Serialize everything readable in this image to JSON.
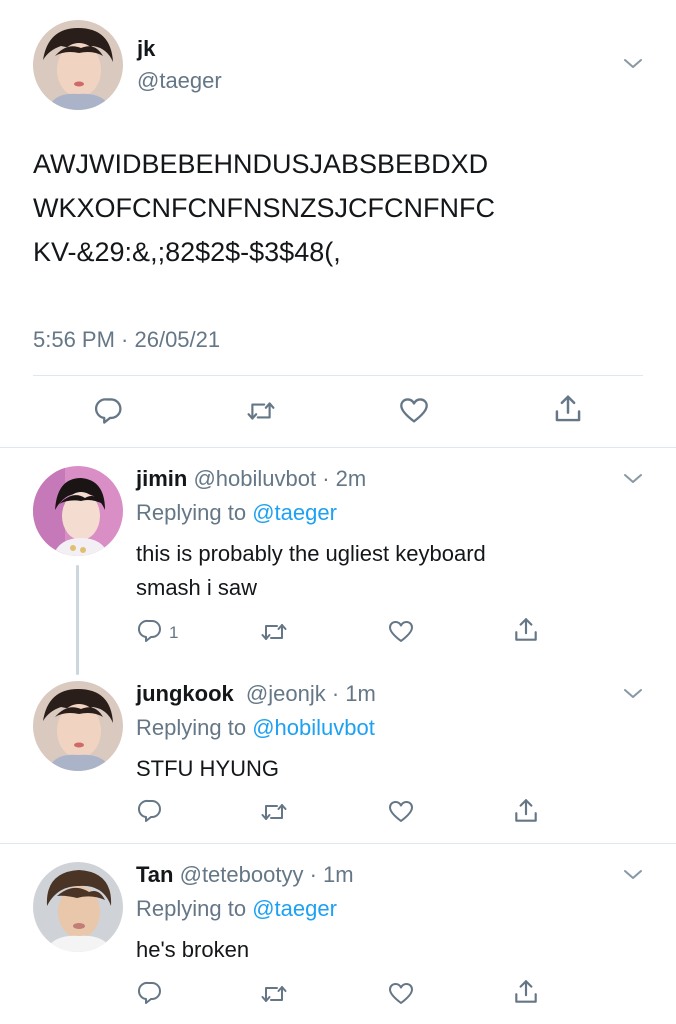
{
  "main_tweet": {
    "display_name": "jk",
    "handle": "@taeger",
    "lines": [
      "AWJWIDBEBEHNDUSJABSBEBDXD",
      "WKXOFCNFCNFNSNZSJCFCNFNFC",
      "KV-&29:&,;82$2$-$3$48(,"
    ],
    "timestamp": "5:56 PM · 26/05/21"
  },
  "replies": [
    {
      "display_name": "jimin",
      "handle": "@hobiluvbot",
      "time": "· 2m",
      "replying_prefix": "Replying to",
      "replying_to": "@taeger",
      "lines": [
        "this is probably the ugliest keyboard",
        "smash i saw"
      ],
      "reply_count": "1"
    },
    {
      "display_name": "jungkook",
      "handle": "@jeonjk",
      "time": "· 1m",
      "replying_prefix": "Replying to",
      "replying_to": "@hobiluvbot",
      "lines": [
        "STFU HYUNG"
      ]
    },
    {
      "display_name": "Tan",
      "handle": "@tetebootyy",
      "time": "· 1m",
      "replying_prefix": "Replying to",
      "replying_to": "@taeger",
      "lines": [
        "he's broken"
      ]
    }
  ],
  "icons": [
    "reply-icon",
    "retweet-icon",
    "like-icon",
    "share-icon",
    "chevron-down-icon"
  ],
  "colors": {
    "text": "#14171a",
    "muted": "#657786",
    "link": "#1da1f2",
    "divider": "#e1e8ed"
  }
}
